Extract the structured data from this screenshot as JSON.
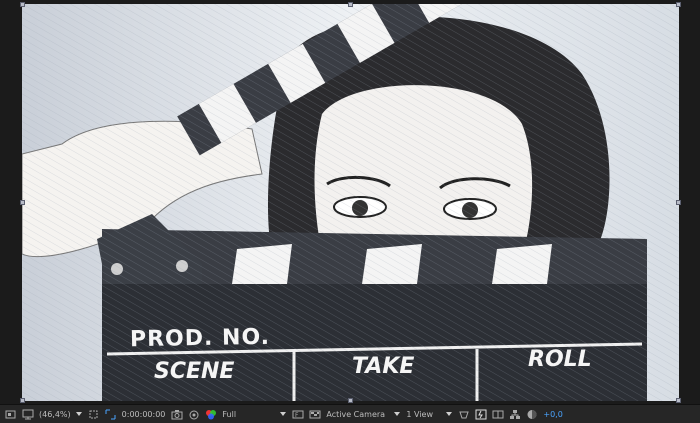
{
  "viewer": {
    "image_description_icon": "clapperboard-photo"
  },
  "toolbar": {
    "zoom": "(46,4%)",
    "timecode": "0:00:00:00",
    "resolution": "Full",
    "camera": "Active Camera",
    "views": "1 View",
    "exposure": "+0,0",
    "accent": "#4aa4ff"
  },
  "clapper": {
    "prod_label": "PROD. NO.",
    "scene_label": "SCENE",
    "take_label": "TAKE",
    "roll_label": "ROLL"
  }
}
